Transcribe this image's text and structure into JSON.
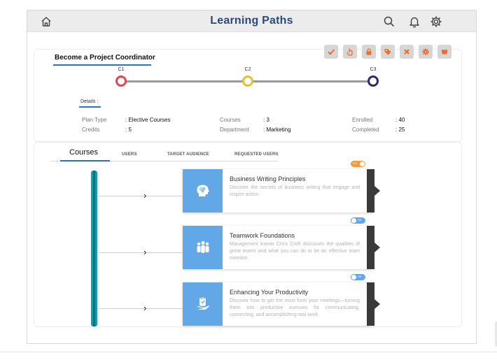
{
  "header": {
    "title": "Learning Paths",
    "icons": [
      "home-icon",
      "search-icon",
      "bell-icon",
      "gear-icon"
    ]
  },
  "plan": {
    "title": "Become a Project Coordinator",
    "actions": [
      {
        "name": "check-icon",
        "color": "#f06a2b"
      },
      {
        "name": "hand-icon",
        "color": "#f06a2b"
      },
      {
        "name": "lock-icon",
        "color": "#f06a2b"
      },
      {
        "name": "tag-icon",
        "color": "#f06a2b"
      },
      {
        "name": "close-icon",
        "color": "#f06a2b"
      },
      {
        "name": "settings-icon",
        "color": "#f06a2b"
      },
      {
        "name": "badge-icon",
        "color": "#f06a2b"
      }
    ],
    "checkpoints": [
      {
        "label": "C1",
        "color": "#e0484f"
      },
      {
        "label": "C2",
        "color": "#e5c130"
      },
      {
        "label": "C3",
        "color": "#2f2a6b"
      }
    ],
    "details_label": "Details :",
    "details": [
      {
        "key": "Plan Type",
        "value": "Elective Courses"
      },
      {
        "key": "Credits",
        "value": "5"
      },
      {
        "key": "Courses",
        "value": "3"
      },
      {
        "key": "Department",
        "value": "Marketing"
      },
      {
        "key": "Enrolled",
        "value": "40"
      },
      {
        "key": "Completed",
        "value": "25"
      }
    ]
  },
  "tabs": [
    {
      "label": "Courses",
      "active": true
    },
    {
      "label": "USERS",
      "active": false
    },
    {
      "label": "TARGET AUDIENCE",
      "active": false
    },
    {
      "label": "REQUESTED USERS",
      "active": false
    }
  ],
  "courses": [
    {
      "title": "Business Writing Principles",
      "description": "Discover the secrets of business writing that engage and inspire action.",
      "icon": "idea-head-icon",
      "toggle": {
        "on": true,
        "label": "ON",
        "color": "#f39a3a"
      }
    },
    {
      "title": "Teamwork Foundations",
      "description": "Management trainer Chris Croft discusses the qualities of great teams and what you can do to be an effective team member.",
      "icon": "team-icon",
      "toggle": {
        "on": false,
        "label": "Off",
        "color": "#62a8e6"
      }
    },
    {
      "title": "Enhancing Your Productivity",
      "description": "Discover how to get the most from your meetings—turning them into productive avenues for communicating, connecting, and accomplishing real work.",
      "icon": "clipboard-hand-icon",
      "toggle": {
        "on": false,
        "label": "Off",
        "color": "#62a8e6"
      }
    }
  ]
}
